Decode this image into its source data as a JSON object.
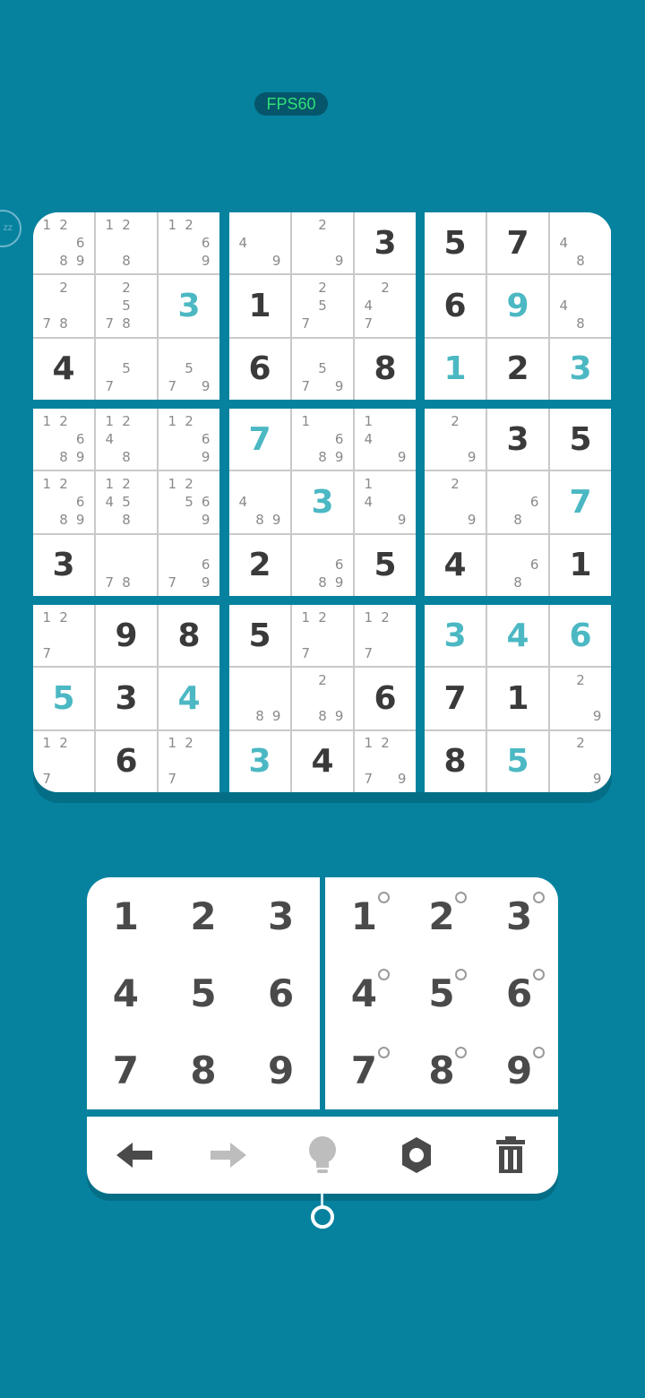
{
  "status": {
    "fps_label": "FPS60"
  },
  "side_badge": {
    "label": "zz"
  },
  "board": {
    "boxes": [
      [
        {
          "notes": [
            "1",
            "2",
            "",
            "",
            "",
            "6",
            "",
            "8",
            "9"
          ]
        },
        {
          "notes": [
            "1",
            "2",
            "",
            "",
            "",
            "",
            "",
            "8",
            ""
          ]
        },
        {
          "notes": [
            "1",
            "2",
            "",
            "",
            "",
            "6",
            "",
            "",
            "9"
          ]
        },
        {
          "notes": [
            "",
            "2",
            "",
            "",
            "",
            "",
            "7",
            "8",
            ""
          ]
        },
        {
          "notes": [
            "",
            "2",
            "",
            "",
            "5",
            "",
            "7",
            "8",
            ""
          ]
        },
        {
          "value": "3",
          "user": true
        },
        {
          "value": "4"
        },
        {
          "notes": [
            "",
            "",
            "",
            "",
            "5",
            "",
            "7",
            "",
            ""
          ]
        },
        {
          "notes": [
            "",
            "",
            "",
            "",
            "5",
            "",
            "7",
            "",
            "9"
          ]
        }
      ],
      [
        {
          "notes": [
            "",
            "",
            "",
            "4",
            "",
            "",
            "",
            "",
            "9"
          ]
        },
        {
          "notes": [
            "",
            "2",
            "",
            "",
            "",
            "",
            "",
            "",
            "9"
          ]
        },
        {
          "value": "3"
        },
        {
          "value": "1"
        },
        {
          "notes": [
            "",
            "2",
            "",
            "",
            "5",
            "",
            "7",
            "",
            ""
          ]
        },
        {
          "notes": [
            "",
            "2",
            "",
            "4",
            "",
            "",
            "7",
            "",
            ""
          ]
        },
        {
          "value": "6"
        },
        {
          "notes": [
            "",
            "",
            "",
            "",
            "5",
            "",
            "7",
            "",
            "9"
          ]
        },
        {
          "value": "8"
        }
      ],
      [
        {
          "value": "5"
        },
        {
          "value": "7"
        },
        {
          "notes": [
            "",
            "",
            "",
            "4",
            "",
            "",
            "",
            "8",
            ""
          ]
        },
        {
          "value": "6"
        },
        {
          "value": "9",
          "user": true
        },
        {
          "notes": [
            "",
            "",
            "",
            "4",
            "",
            "",
            "",
            "8",
            ""
          ]
        },
        {
          "value": "1",
          "user": true
        },
        {
          "value": "2"
        },
        {
          "value": "3",
          "user": true
        }
      ],
      [
        {
          "notes": [
            "1",
            "2",
            "",
            "",
            "",
            "6",
            "",
            "8",
            "9"
          ]
        },
        {
          "notes": [
            "1",
            "2",
            "",
            "4",
            "",
            "",
            "",
            "8",
            ""
          ]
        },
        {
          "notes": [
            "1",
            "2",
            "",
            "",
            "",
            "6",
            "",
            "",
            "9"
          ]
        },
        {
          "notes": [
            "1",
            "2",
            "",
            "",
            "",
            "6",
            "",
            "8",
            "9"
          ]
        },
        {
          "notes": [
            "1",
            "2",
            "",
            "4",
            "5",
            "",
            "",
            "8",
            ""
          ]
        },
        {
          "notes": [
            "1",
            "2",
            "",
            "",
            "5",
            "6",
            "",
            "",
            "9"
          ]
        },
        {
          "value": "3"
        },
        {
          "notes": [
            "",
            "",
            "",
            "",
            "",
            "",
            "7",
            "8",
            ""
          ]
        },
        {
          "notes": [
            "",
            "",
            "",
            "",
            "",
            "6",
            "7",
            "",
            "9"
          ]
        }
      ],
      [
        {
          "value": "7",
          "user": true
        },
        {
          "notes": [
            "1",
            "",
            "",
            "",
            "",
            "6",
            "",
            "8",
            "9"
          ]
        },
        {
          "notes": [
            "1",
            "",
            "",
            "4",
            "",
            "",
            "",
            "",
            "9"
          ]
        },
        {
          "notes": [
            "",
            "",
            "",
            "4",
            "",
            "",
            "",
            "8",
            "9"
          ]
        },
        {
          "value": "3",
          "user": true
        },
        {
          "notes": [
            "1",
            "",
            "",
            "4",
            "",
            "",
            "",
            "",
            "9"
          ]
        },
        {
          "value": "2"
        },
        {
          "notes": [
            "",
            "",
            "",
            "",
            "",
            "6",
            "",
            "8",
            "9"
          ]
        },
        {
          "value": "5"
        }
      ],
      [
        {
          "notes": [
            "",
            "2",
            "",
            "",
            "",
            "",
            "",
            "",
            "9"
          ]
        },
        {
          "value": "3"
        },
        {
          "value": "5"
        },
        {
          "notes": [
            "",
            "2",
            "",
            "",
            "",
            "",
            "",
            "",
            "9"
          ]
        },
        {
          "notes": [
            "",
            "",
            "",
            "",
            "",
            "6",
            "",
            "8",
            ""
          ]
        },
        {
          "value": "7",
          "user": true
        },
        {
          "value": "4"
        },
        {
          "notes": [
            "",
            "",
            "",
            "",
            "",
            "6",
            "",
            "8",
            ""
          ]
        },
        {
          "value": "1"
        }
      ],
      [
        {
          "notes": [
            "1",
            "2",
            "",
            "",
            "",
            "",
            "7",
            "",
            ""
          ]
        },
        {
          "value": "9"
        },
        {
          "value": "8"
        },
        {
          "value": "5",
          "user": true
        },
        {
          "value": "3"
        },
        {
          "value": "4",
          "user": true
        },
        {
          "notes": [
            "1",
            "2",
            "",
            "",
            "",
            "",
            "7",
            "",
            ""
          ]
        },
        {
          "value": "6"
        },
        {
          "notes": [
            "1",
            "2",
            "",
            "",
            "",
            "",
            "7",
            "",
            ""
          ]
        }
      ],
      [
        {
          "value": "5"
        },
        {
          "notes": [
            "1",
            "2",
            "",
            "",
            "",
            "",
            "7",
            "",
            ""
          ]
        },
        {
          "notes": [
            "1",
            "2",
            "",
            "",
            "",
            "",
            "7",
            "",
            ""
          ]
        },
        {
          "notes": [
            "",
            "",
            "",
            "",
            "",
            "",
            "",
            "8",
            "9"
          ]
        },
        {
          "notes": [
            "",
            "2",
            "",
            "",
            "",
            "",
            "",
            "8",
            "9"
          ]
        },
        {
          "value": "6"
        },
        {
          "value": "3",
          "user": true
        },
        {
          "value": "4"
        },
        {
          "notes": [
            "1",
            "2",
            "",
            "",
            "",
            "",
            "7",
            "",
            "9"
          ]
        }
      ],
      [
        {
          "value": "3",
          "user": true
        },
        {
          "value": "4",
          "user": true
        },
        {
          "value": "6",
          "user": true
        },
        {
          "value": "7"
        },
        {
          "value": "1"
        },
        {
          "notes": [
            "",
            "2",
            "",
            "",
            "",
            "",
            "",
            "",
            "9"
          ]
        },
        {
          "value": "8"
        },
        {
          "value": "5",
          "user": true
        },
        {
          "notes": [
            "",
            "2",
            "",
            "",
            "",
            "",
            "",
            "",
            "9"
          ]
        }
      ]
    ]
  },
  "number_pad": {
    "keys": [
      "1",
      "2",
      "3",
      "4",
      "5",
      "6",
      "7",
      "8",
      "9"
    ]
  },
  "note_pad": {
    "keys": [
      "1",
      "2",
      "3",
      "4",
      "5",
      "6",
      "7",
      "8",
      "9"
    ]
  },
  "toolbar": {
    "tools": [
      {
        "name": "undo-icon",
        "color": "#4a4a4a"
      },
      {
        "name": "redo-icon",
        "color": "#bdbdbd"
      },
      {
        "name": "hint-bulb-icon",
        "color": "#bdbdbd"
      },
      {
        "name": "settings-gear-icon",
        "color": "#4a4a4a"
      },
      {
        "name": "trash-icon",
        "color": "#4a4a4a"
      }
    ]
  },
  "colors": {
    "background": "#06829f",
    "given_digit": "#3a3a3a",
    "user_digit": "#4bb8c3",
    "note_digit": "#8a8a8a"
  }
}
